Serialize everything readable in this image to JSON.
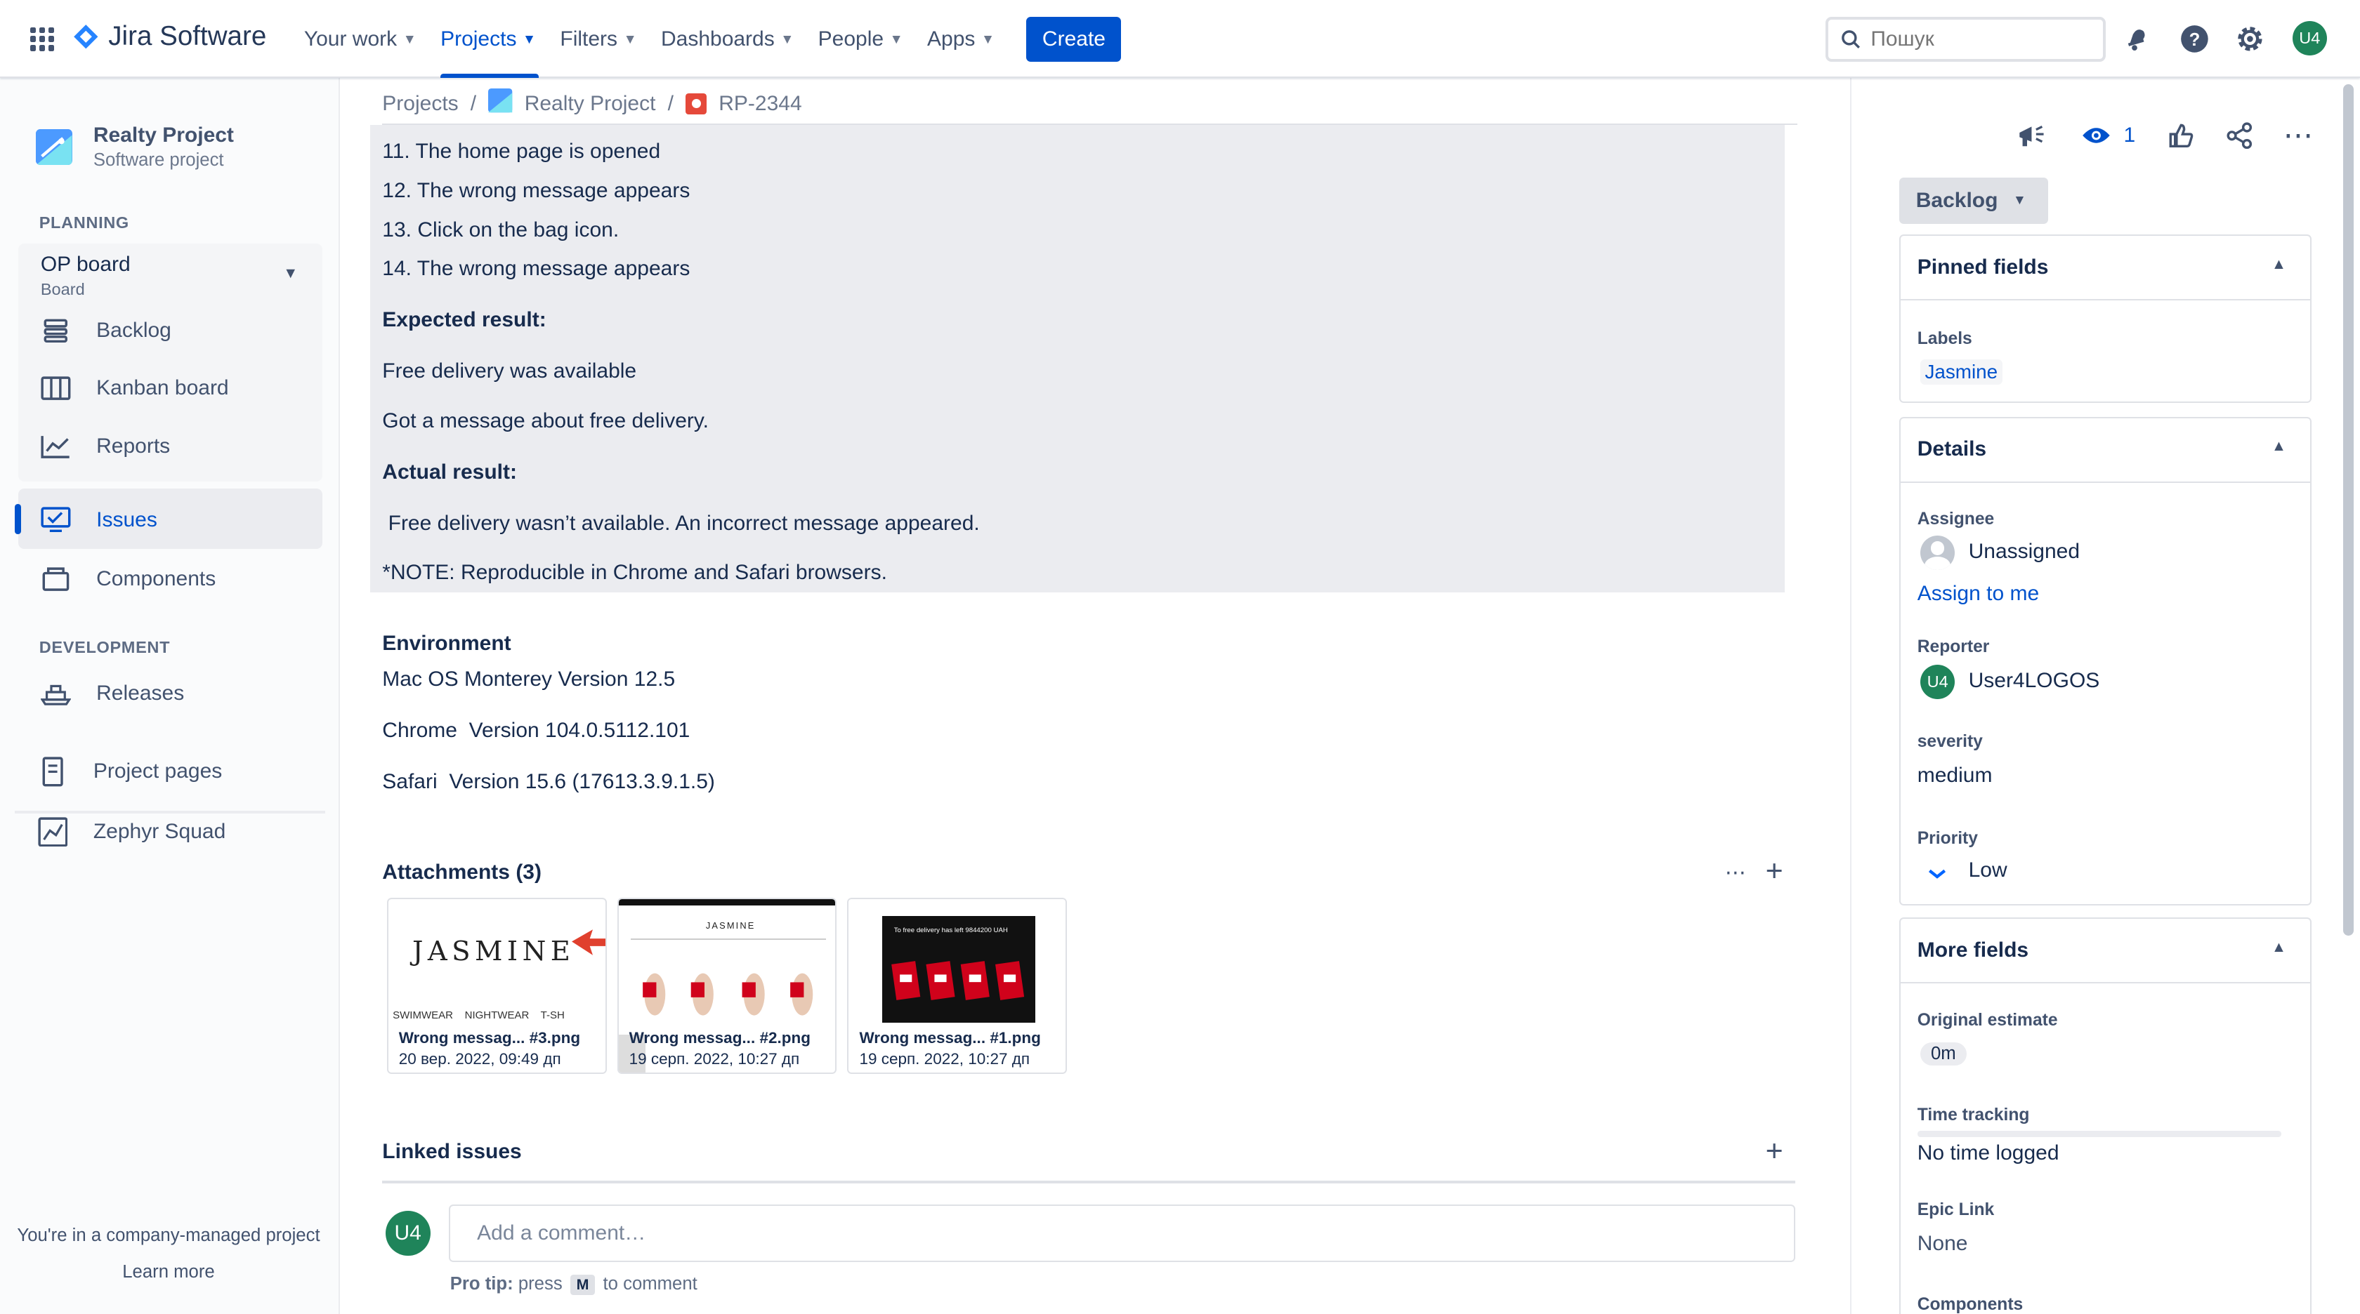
{
  "topnav": {
    "product": "Jira Software",
    "items": [
      {
        "label": "Your work"
      },
      {
        "label": "Projects"
      },
      {
        "label": "Filters"
      },
      {
        "label": "Dashboards"
      },
      {
        "label": "People"
      },
      {
        "label": "Apps"
      }
    ],
    "create_label": "Create",
    "search_placeholder": "Пошук",
    "user_initials": "U4",
    "accent": "#0052CC"
  },
  "sidebar": {
    "project_name": "Realty Project",
    "project_type": "Software project",
    "planning_heading": "PLANNING",
    "board_title": "OP board",
    "board_subtitle": "Board",
    "board_items": [
      {
        "label": "Backlog",
        "icon": "backlog-icon"
      },
      {
        "label": "Kanban board",
        "icon": "kanban-board-icon"
      },
      {
        "label": "Reports",
        "icon": "reports-icon"
      }
    ],
    "issues_label": "Issues",
    "components_label": "Components",
    "development_heading": "DEVELOPMENT",
    "releases_label": "Releases",
    "project_pages_label": "Project pages",
    "zephyr_label": "Zephyr Squad",
    "company_note": "You're in a company-managed project",
    "learn_more": "Learn more"
  },
  "breadcrumb": {
    "projects": "Projects",
    "project": "Realty Project",
    "issue_key": "RP-2344"
  },
  "description": {
    "steps": [
      "11. The home page is opened",
      "12. The wrong message appears",
      "13. Click on the bag icon.",
      "14. The wrong message appears"
    ],
    "expected_heading": "Expected result:",
    "expected_1": "Free delivery was available",
    "expected_2": "Got a message about free delivery.",
    "actual_heading": "Actual result:",
    "actual_1": " Free delivery wasn’t available. An incorrect message appeared.",
    "note": "*NOTE: Reproducible in Chrome and Safari browsers."
  },
  "environment": {
    "heading": "Environment",
    "os": "Mac OS Monterey Version 12.5",
    "chrome": "Chrome  Version 104.0.5112.101",
    "safari": "Safari  Version 15.6 (17613.3.9.1.5)"
  },
  "attachments": {
    "heading": "Attachments (3)",
    "items": [
      {
        "name": "Wrong messag... #3.png",
        "date": "20 вер. 2022, 09:49 дп",
        "thumb_text": "JASMINE",
        "thumb_sub": "SWIMWEAR    NIGHTWEAR    T-SH"
      },
      {
        "name": "Wrong messag... #2.png",
        "date": "19 серп. 2022, 10:27 дп",
        "thumb_text": "JASMINE"
      },
      {
        "name": "Wrong messag... #1.png",
        "date": "19 серп. 2022, 10:27 дп",
        "thumb_text": "To free delivery has left 9844200 UAH"
      }
    ]
  },
  "linked_issues": {
    "heading": "Linked issues"
  },
  "comment": {
    "avatar_initials": "U4",
    "placeholder": "Add a comment…",
    "protip_label": "Pro tip:",
    "protip_press": "press",
    "protip_key": "M",
    "protip_rest": "to comment"
  },
  "right_panel": {
    "watchers_count": "1",
    "status": "Backlog",
    "pinned": {
      "heading": "Pinned fields",
      "labels_label": "Labels",
      "labels_value": "Jasmine"
    },
    "details": {
      "heading": "Details",
      "assignee_label": "Assignee",
      "assignee_value": "Unassigned",
      "assign_to_me": "Assign to me",
      "reporter_label": "Reporter",
      "reporter_initials": "U4",
      "reporter_value": "User4LOGOS",
      "severity_label": "severity",
      "severity_value": "medium",
      "priority_label": "Priority",
      "priority_value": "Low"
    },
    "more_fields": {
      "heading": "More fields",
      "original_estimate_label": "Original estimate",
      "original_estimate_value": "0m",
      "time_tracking_label": "Time tracking",
      "time_tracking_value": "No time logged",
      "epic_link_label": "Epic Link",
      "epic_link_value": "None",
      "components_label": "Components"
    }
  }
}
